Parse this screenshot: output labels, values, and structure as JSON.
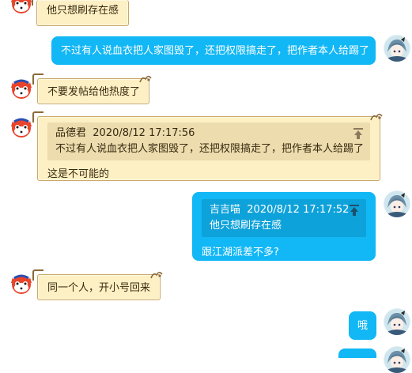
{
  "messages": [
    {
      "side": "left",
      "text": "他只想刷存在感"
    },
    {
      "side": "right",
      "text": "不过有人说血衣把人家图毁了，还把权限搞走了，把作者本人给踢了"
    },
    {
      "side": "left",
      "text": "不要发帖给他热度了"
    },
    {
      "side": "left",
      "quote": {
        "author": "品德君",
        "time": "2020/8/12 17:17:56",
        "text": "不过有人说血衣把人家图毁了，还把权限搞走了，把作者本人给踢了"
      },
      "text": "这是不可能的"
    },
    {
      "side": "right",
      "quote": {
        "author": "吉吉喵",
        "time": "2020/8/12 17:17:52",
        "text": "他只想刷存在感"
      },
      "text": "跟江湖派差不多?"
    },
    {
      "side": "left",
      "text": "同一个人，开小号回来"
    },
    {
      "side": "right",
      "text": "哦"
    }
  ],
  "icons": {
    "left_avatar": "cartoon-fox-avatar",
    "right_avatar": "anime-girl-avatar",
    "quote_jump": "arrow-up-to-line-icon"
  },
  "colors": {
    "left_bubble": "#fdf0c4",
    "left_border": "#c9a76c",
    "left_quote": "#ecdcae",
    "right_bubble": "#12b7f5",
    "right_quote": "#0ea2da"
  }
}
